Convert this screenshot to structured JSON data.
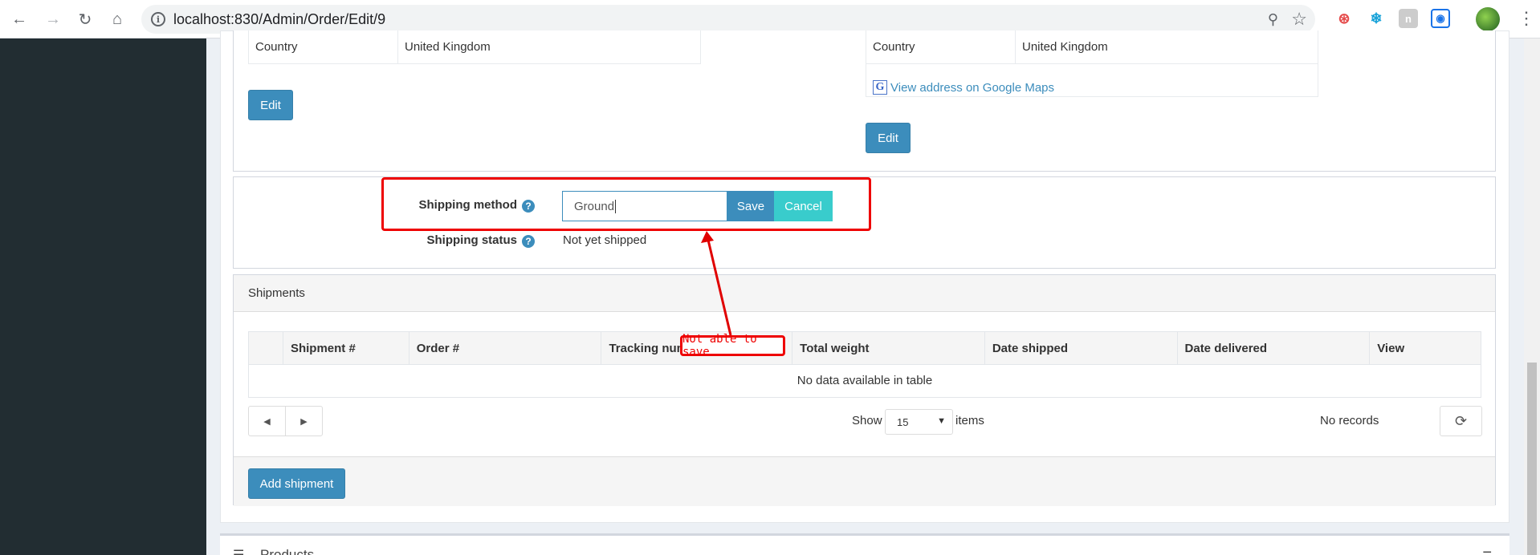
{
  "browser": {
    "url": "localhost:830/Admin/Order/Edit/9"
  },
  "billing_address": {
    "country_label": "Country",
    "country_value": "United Kingdom",
    "edit_label": "Edit"
  },
  "shipping_address": {
    "country_label": "Country",
    "country_value": "United Kingdom",
    "google_maps_label": "View address on Google Maps",
    "edit_label": "Edit"
  },
  "shipping": {
    "method_label": "Shipping method",
    "method_value": "Ground",
    "save_label": "Save",
    "cancel_label": "Cancel",
    "status_label": "Shipping status",
    "status_value": "Not yet shipped"
  },
  "annotation": {
    "text": "Not able to save",
    "color": "#e00000"
  },
  "shipments": {
    "title": "Shipments",
    "columns": [
      "",
      "Shipment #",
      "Order #",
      "Tracking num",
      "Total weight",
      "Date shipped",
      "Date delivered",
      "View"
    ],
    "empty_text": "No data available in table",
    "show_label": "Show",
    "page_size": "15",
    "items_label": "items",
    "records_text": "No records",
    "add_label": "Add shipment"
  },
  "products": {
    "title": "Products"
  },
  "colors": {
    "primary": "#3c8dbc",
    "cancel": "#39cccc",
    "sidebar": "#222d32"
  }
}
